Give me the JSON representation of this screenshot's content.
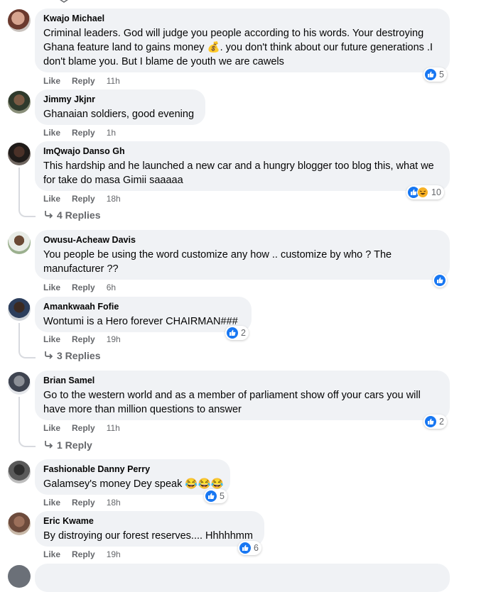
{
  "comments": [
    {
      "name": "Kwajo Michael",
      "text": "Criminal leaders. God will judge you people according to his words. Your destroying Ghana feature land to gains money 💰. you don't think about our future generations .I don't blame you. But I blame de youth we are cawels",
      "like": "Like",
      "reply": "Reply",
      "time": "11h",
      "reactions": "5"
    },
    {
      "name": "Jimmy Jkjnr",
      "text": "Ghanaian soldiers, good evening",
      "like": "Like",
      "reply": "Reply",
      "time": "1h"
    },
    {
      "name": "ImQwajo Danso Gh",
      "text": "This hardship and he launched a new car and a hungry blogger too blog this, what we for take do masa Gimii saaaaa",
      "like": "Like",
      "reply": "Reply",
      "time": "18h",
      "reactions": "10",
      "replies": "4 Replies"
    },
    {
      "name": "Owusu-Acheaw Davis",
      "text": "You people be using the word customize any how .. customize by who ? The manufacturer ??",
      "like": "Like",
      "reply": "Reply",
      "time": "6h"
    },
    {
      "name": "Amankwaah Fofie",
      "text": "Wontumi is a Hero forever CHAIRMAN###",
      "like": "Like",
      "reply": "Reply",
      "time": "19h",
      "reactions": "2",
      "replies": "3 Replies"
    },
    {
      "name": "Brian Samel",
      "text": "Go to the western world and as a member of parliament show off your cars you will have more than million questions to answer",
      "like": "Like",
      "reply": "Reply",
      "time": "11h",
      "reactions": "2",
      "replies": "1 Reply"
    },
    {
      "name": "Fashionable Danny Perry",
      "text": "Galamsey's money Dey speak 😂😂😂",
      "like": "Like",
      "reply": "Reply",
      "time": "18h",
      "reactions": "5"
    },
    {
      "name": "Eric Kwame",
      "text": "By distroying our forest reserves.... Hhhhhmm",
      "like": "Like",
      "reply": "Reply",
      "time": "19h",
      "reactions": "6"
    }
  ],
  "icons": {
    "like": "like-reaction-icon",
    "haha": "haha-reaction-icon",
    "reply_arrow": "reply-arrow-icon"
  },
  "colors": {
    "bubble": "#f0f2f5",
    "like_blue": "#1877f2",
    "muted": "#65676b"
  }
}
